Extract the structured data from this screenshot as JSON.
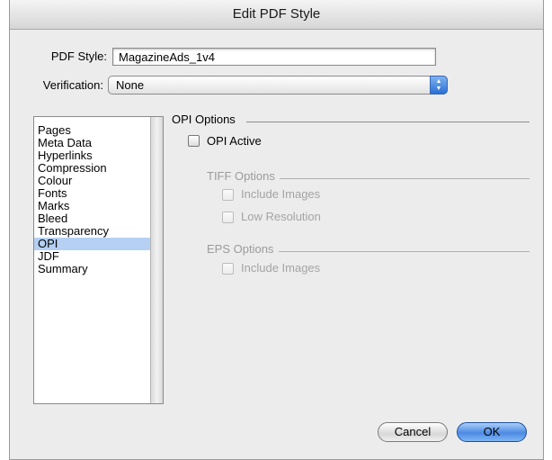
{
  "window": {
    "title": "Edit PDF Style"
  },
  "form": {
    "pdf_style_label": "PDF Style:",
    "pdf_style_value": "MagazineAds_1v4",
    "verification_label": "Verification:",
    "verification_value": "None"
  },
  "sidebar": {
    "items": [
      {
        "label": "Pages",
        "selected": false
      },
      {
        "label": "Meta Data",
        "selected": false
      },
      {
        "label": "Hyperlinks",
        "selected": false
      },
      {
        "label": "Compression",
        "selected": false
      },
      {
        "label": "Colour",
        "selected": false
      },
      {
        "label": "Fonts",
        "selected": false
      },
      {
        "label": "Marks",
        "selected": false
      },
      {
        "label": "Bleed",
        "selected": false
      },
      {
        "label": "Transparency",
        "selected": false
      },
      {
        "label": "OPI",
        "selected": true
      },
      {
        "label": "JDF",
        "selected": false
      },
      {
        "label": "Summary",
        "selected": false
      }
    ]
  },
  "opi": {
    "section_title": "OPI Options",
    "opi_active_label": "OPI Active",
    "opi_active_checked": false,
    "tiff": {
      "title": "TIFF Options",
      "include_images_label": "Include Images",
      "low_resolution_label": "Low Resolution"
    },
    "eps": {
      "title": "EPS Options",
      "include_images_label": "Include Images"
    }
  },
  "buttons": {
    "cancel": "Cancel",
    "ok": "OK"
  },
  "colors": {
    "selection": "#b5d0f3",
    "default_button": "#4d8ae4",
    "disabled_text": "#9b9b9b"
  }
}
